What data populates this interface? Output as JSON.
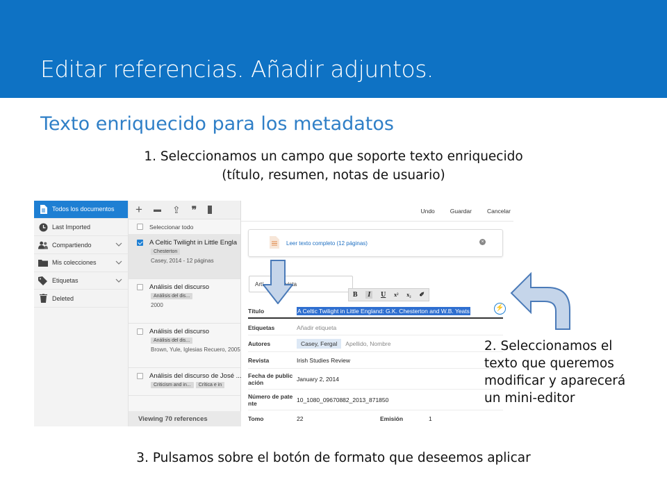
{
  "slide": {
    "title": "Editar referencias. Añadir adjuntos.",
    "subtitle": "Texto enriquecido para los metadatos",
    "step1_line1": "1. Seleccionamos un campo que soporte texto enriquecido",
    "step1_line2": "(título, resumen, notas de usuario)",
    "step2_lines": [
      "2. Seleccionamos el",
      "texto que queremos",
      "modificar y aparecerá",
      "un mini-editor"
    ],
    "step3": "3. Pulsamos sobre el botón de formato que deseemos aplicar",
    "colors": {
      "header_band": "#0e72c4",
      "subtitle": "#2f7fc7",
      "accent": "#1e7fd3",
      "arrow_fill": "#c5d5ea",
      "arrow_stroke": "#4a7ab8"
    }
  },
  "sidebar": {
    "items": [
      {
        "label": "Todos los documentos",
        "icon": "document-icon",
        "active": true
      },
      {
        "label": "Last Imported",
        "icon": "clock-icon"
      },
      {
        "label": "Compartiendo",
        "icon": "people-icon",
        "expandable": true
      },
      {
        "label": "Mis colecciones",
        "icon": "folder-icon",
        "expandable": true
      },
      {
        "label": "Etiquetas",
        "icon": "tag-icon",
        "expandable": true
      },
      {
        "label": "Deleted",
        "icon": "trash-icon"
      }
    ]
  },
  "list": {
    "toolbar_icons": [
      "add-icon",
      "folder-icon",
      "share-icon",
      "quote-icon",
      "trash-icon"
    ],
    "toolbar_glyphs": [
      "+",
      "▬",
      "⇪",
      "❞"
    ],
    "select_all": "Seleccionar todo",
    "docs": [
      {
        "title": "A Celtic Twilight in Little Engla",
        "tags": [
          "Chesterton"
        ],
        "meta": "Casey, 2014 - 12 páginas",
        "selected": true
      },
      {
        "title": "Análisis del discurso",
        "tags": [
          "Análisis del dis..."
        ],
        "meta": "2000"
      },
      {
        "title": "Análisis del discurso",
        "tags": [
          "Análisis del dis..."
        ],
        "meta": "Brown, Yule, Iglesias Recuero, 2005"
      },
      {
        "title": "Análisis del discurso de José ...",
        "tags": [
          "Criticism and in...",
          "Crítica e in"
        ],
        "meta": ""
      }
    ],
    "footer": "Viewing 70 references"
  },
  "detail": {
    "actions": [
      "Undo",
      "Guardar",
      "Cancelar"
    ],
    "fulltext_link": "Leer texto completo (12 páginas)",
    "type_select_prefix": "Artí",
    "type_select_suffix": "revista",
    "minieditor_buttons": [
      "B",
      "I",
      "U",
      "x²",
      "x₂",
      "✐"
    ],
    "fields": {
      "titulo_label": "Título",
      "titulo_value": "A Celtic Twilight in Little England: G.K. Chesterton and W.B. Yeats",
      "etiquetas_label": "Etiquetas",
      "etiquetas_placeholder": "Añadir etiqueta",
      "autores_label": "Autores",
      "autor_chip": "Casey, Fergal",
      "autor_placeholder": "Apellido, Nombre",
      "revista_label": "Revista",
      "revista_value": "Irish Studies Review",
      "fecha_label_1": "Fecha de public",
      "fecha_label_2": "ación",
      "fecha_value": "January 2, 2014",
      "numero_label_1": "Número de pate",
      "numero_label_2": "nte",
      "numero_value": "10_1080_09670882_2013_871850",
      "tomo_label": "Tomo",
      "tomo_value": "22",
      "emision_label": "Emisión",
      "emision_value": "1"
    },
    "bolt_glyph": "⚡"
  }
}
